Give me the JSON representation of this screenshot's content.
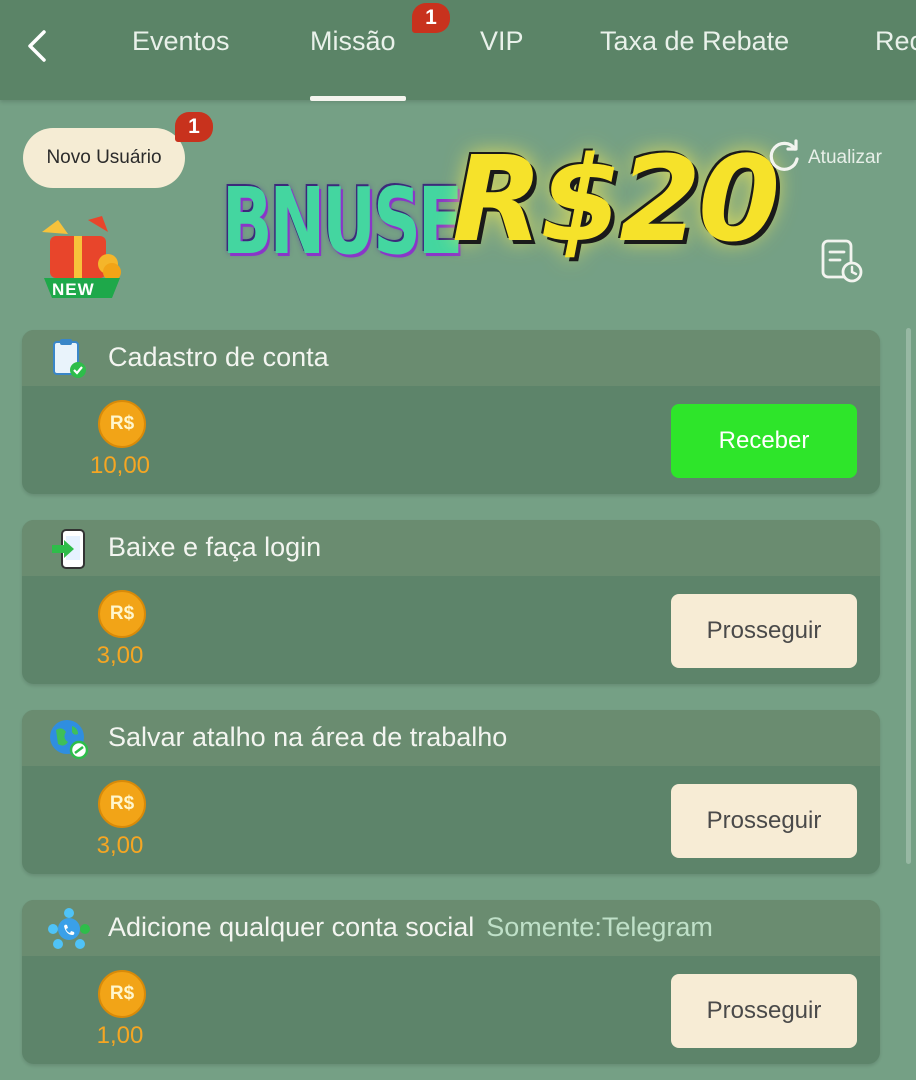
{
  "nav": {
    "tabs": [
      {
        "label": "Eventos"
      },
      {
        "label": "Missão",
        "badge": "1",
        "active": true
      },
      {
        "label": "VIP"
      },
      {
        "label": "Taxa de Rebate"
      },
      {
        "label": "Rec"
      }
    ]
  },
  "header": {
    "novo_usuario_label": "Novo Usuário",
    "novo_badge": "1",
    "gift_tag": "NEW",
    "banner_left": "BNUSE",
    "banner_right": "R$20",
    "refresh_label": "Atualizar"
  },
  "missions": [
    {
      "title": "Cadastro de conta",
      "note": "",
      "coin": "R$",
      "amount": "10,00",
      "button": "Receber",
      "button_style": "green",
      "icon": "clipboard-check-icon"
    },
    {
      "title": "Baixe e faça login",
      "note": "",
      "coin": "R$",
      "amount": "3,00",
      "button": "Prosseguir",
      "button_style": "cream",
      "icon": "phone-login-icon"
    },
    {
      "title": "Salvar atalho na área de trabalho",
      "note": "",
      "coin": "R$",
      "amount": "3,00",
      "button": "Prosseguir",
      "button_style": "cream",
      "icon": "globe-link-icon"
    },
    {
      "title": "Adicione qualquer conta social",
      "note": "Somente:Telegram",
      "coin": "R$",
      "amount": "1,00",
      "button": "Prosseguir",
      "button_style": "cream",
      "icon": "social-network-icon"
    }
  ],
  "colors": {
    "accent_green": "#2ee52a",
    "coin_orange": "#f2a417",
    "badge_red": "#c8321d",
    "banner_yellow": "#f6e22a"
  }
}
